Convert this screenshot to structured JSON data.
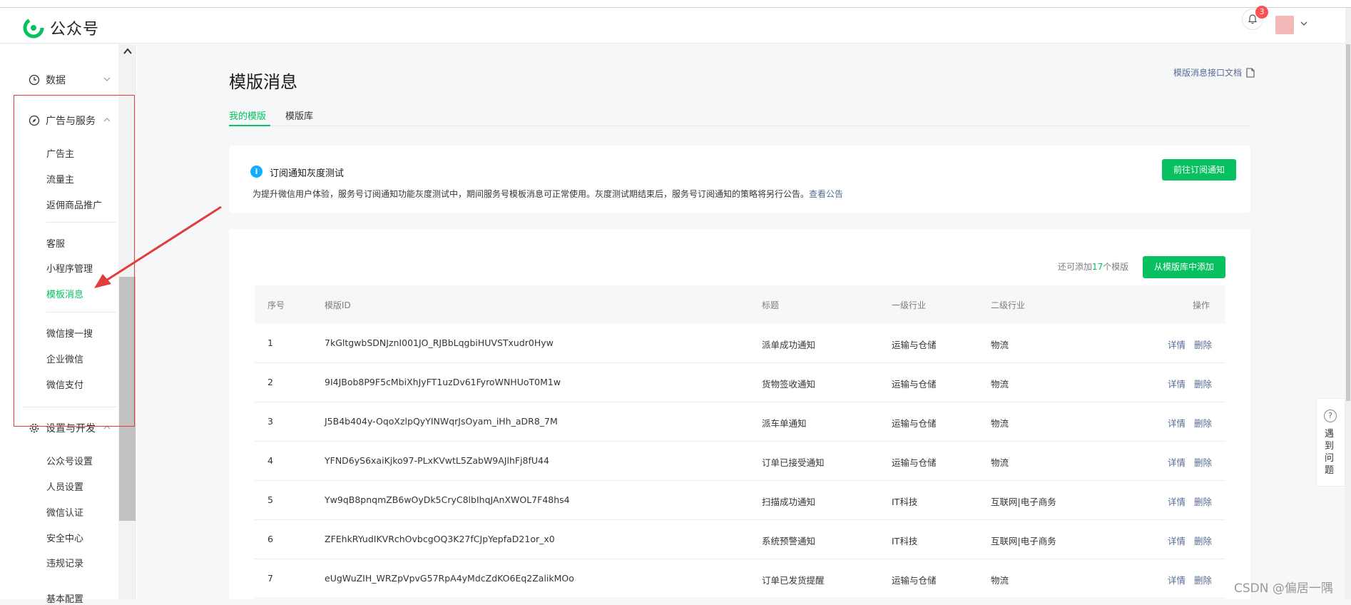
{
  "app": {
    "name": "公众号",
    "notification_count": "3"
  },
  "sidebar": {
    "groups": [
      {
        "label": "数据",
        "icon": "clock-icon"
      },
      {
        "label": "广告与服务",
        "icon": "compass-icon"
      },
      {
        "label": "设置与开发",
        "icon": "gear-icon"
      }
    ],
    "ad_items": [
      "广告主",
      "流量主",
      "返佣商品推广"
    ],
    "service_items": [
      "客服",
      "小程序管理",
      "模板消息"
    ],
    "wx_items": [
      "微信搜一搜",
      "企业微信",
      "微信支付"
    ],
    "settings_items": [
      "公众号设置",
      "人员设置",
      "微信认证",
      "安全中心",
      "违规记录",
      "基本配置"
    ],
    "active_item": "模板消息"
  },
  "page": {
    "title": "模版消息",
    "doc_link": "模版消息接口文档",
    "tabs": [
      "我的模版",
      "模版库"
    ]
  },
  "notice": {
    "icon": "info-icon",
    "title": "订阅通知灰度测试",
    "desc": "为提升微信用户体验，服务号订阅通知功能灰度测试中，期间服务号模板消息可正常使用。灰度测试期结束后，服务号订阅通知的策略将另行公告。",
    "link": "查看公告",
    "button": "前往订阅通知"
  },
  "templates": {
    "quota_prefix": "还可添加",
    "quota_count": "17",
    "quota_suffix": "个模版",
    "add_button": "从模版库中添加",
    "headers": [
      "序号",
      "模版ID",
      "标题",
      "一级行业",
      "二级行业",
      "操作"
    ],
    "rows": [
      {
        "no": "1",
        "id": "7kGltgwbSDNJznI001JO_RJBbLqgbiHUVSTxudr0Hyw",
        "title": "派单成功通知",
        "ind1": "运输与仓储",
        "ind2": "物流"
      },
      {
        "no": "2",
        "id": "9I4JBob8P9F5cMbiXhJyFT1uzDv61FyroWNHUoT0M1w",
        "title": "货物签收通知",
        "ind1": "运输与仓储",
        "ind2": "物流"
      },
      {
        "no": "3",
        "id": "J5B4b404y-OqoXzlpQyYINWqrJsOyam_iHh_aDR8_7M",
        "title": "派车单通知",
        "ind1": "运输与仓储",
        "ind2": "物流"
      },
      {
        "no": "4",
        "id": "YFND6yS6xaiKjko97-PLxKVwtL5ZabW9AJlhFj8fU44",
        "title": "订单已接受通知",
        "ind1": "运输与仓储",
        "ind2": "物流"
      },
      {
        "no": "5",
        "id": "Yw9qB8pnqmZB6wOyDk5CryC8lbIhqJAnXWOL7F48hs4",
        "title": "扫描成功通知",
        "ind1": "IT科技",
        "ind2": "互联网|电子商务"
      },
      {
        "no": "6",
        "id": "ZFEhkRYudIKVRchOvbcgOQ3K27fCJpYepfaD21or_x0",
        "title": "系统预警通知",
        "ind1": "IT科技",
        "ind2": "互联网|电子商务"
      },
      {
        "no": "7",
        "id": "eUgWuZIH_WRZpVpvG57RpA4yMdcZdKO6Eq2ZalikMOo",
        "title": "订单已发货提醒",
        "ind1": "运输与仓储",
        "ind2": "物流"
      }
    ],
    "op_detail": "详情",
    "op_delete": "删除"
  },
  "help": {
    "label": "遇到问题"
  },
  "watermark": "CSDN @偏居一隅",
  "colors": {
    "accent": "#07c160",
    "link": "#576b95",
    "annotation": "#e23d3d",
    "badge": "#fa5151",
    "info": "#10aeff"
  }
}
